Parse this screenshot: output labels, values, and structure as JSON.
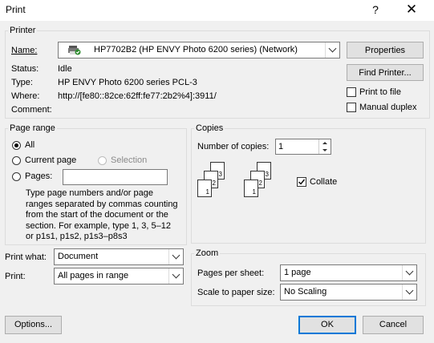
{
  "window": {
    "title": "Print",
    "help_glyph": "?",
    "close_glyph": "✕"
  },
  "printer": {
    "group_label": "Printer",
    "name_label": "Name:",
    "name_value": "HP7702B2 (HP ENVY Photo 6200 series) (Network)",
    "status_label": "Status:",
    "status_value": "Idle",
    "type_label": "Type:",
    "type_value": "HP ENVY Photo 6200 series PCL-3",
    "where_label": "Where:",
    "where_value": "http://[fe80::82ce:62ff:fe77:2b2%4]:3911/",
    "comment_label": "Comment:",
    "properties_button": "Properties",
    "find_printer_button": "Find Printer...",
    "print_to_file_label": "Print to file",
    "manual_duplex_label": "Manual duplex"
  },
  "page_range": {
    "group_label": "Page range",
    "all_label": "All",
    "current_page_label": "Current page",
    "selection_label": "Selection",
    "pages_label": "Pages:",
    "pages_value": "",
    "help_text": "Type page numbers and/or page ranges separated by commas counting from the start of the document or the section. For example, type 1, 3, 5–12 or p1s1, p1s2, p1s3–p8s3"
  },
  "copies": {
    "group_label": "Copies",
    "number_label": "Number of copies:",
    "number_value": "1",
    "collate_label": "Collate",
    "collate_checked": true,
    "page_numbers": [
      "1",
      "2",
      "3"
    ]
  },
  "print_what": {
    "label": "Print what:",
    "value": "Document"
  },
  "print": {
    "label": "Print:",
    "value": "All pages in range"
  },
  "zoom": {
    "group_label": "Zoom",
    "pages_per_sheet_label": "Pages per sheet:",
    "pages_per_sheet_value": "1 page",
    "scale_label": "Scale to paper size:",
    "scale_value": "No Scaling"
  },
  "footer": {
    "options_button": "Options...",
    "ok_button": "OK",
    "cancel_button": "Cancel"
  },
  "colors": {
    "accent": "#0078d7",
    "background": "#f0f0f0"
  }
}
